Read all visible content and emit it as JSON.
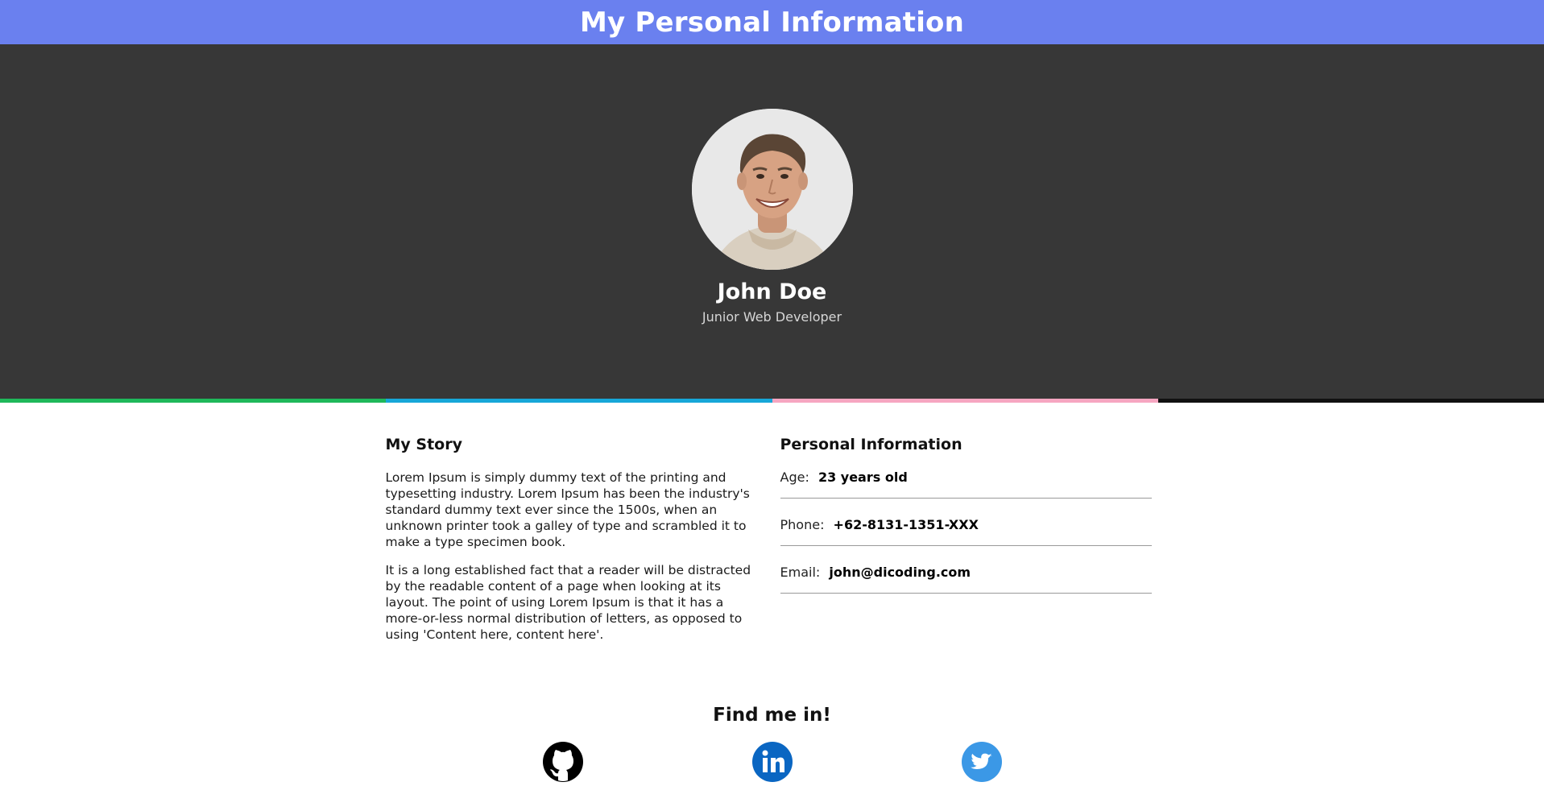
{
  "header": {
    "title": "My Personal Information"
  },
  "profile": {
    "name": "John Doe",
    "role": "Junior Web Developer"
  },
  "stripe_colors": [
    "#1fb85a",
    "#17a7d8",
    "#f6a6c1",
    "#111111"
  ],
  "story": {
    "heading": "My Story",
    "paragraphs": [
      "Lorem Ipsum is simply dummy text of the printing and typesetting industry. Lorem Ipsum has been the industry's standard dummy text ever since the 1500s, when an unknown printer took a galley of type and scrambled it to make a type specimen book.",
      "It is a long established fact that a reader will be distracted by the readable content of a page when looking at its layout. The point of using Lorem Ipsum is that it has a more-or-less normal distribution of letters, as opposed to using 'Content here, content here'."
    ]
  },
  "info": {
    "heading": "Personal Information",
    "rows": [
      {
        "label": "Age:",
        "value": "23 years old"
      },
      {
        "label": "Phone:",
        "value": "+62-8131-1351-XXX"
      },
      {
        "label": "Email:",
        "value": "john@dicoding.com"
      }
    ]
  },
  "find": {
    "heading": "Find me in!",
    "socials": [
      {
        "name": "github",
        "icon": "github-icon",
        "color": "#000000"
      },
      {
        "name": "linkedin",
        "icon": "linkedin-icon",
        "color": "#0a66c2"
      },
      {
        "name": "twitter",
        "icon": "twitter-icon",
        "color": "#3b98e6"
      }
    ]
  }
}
